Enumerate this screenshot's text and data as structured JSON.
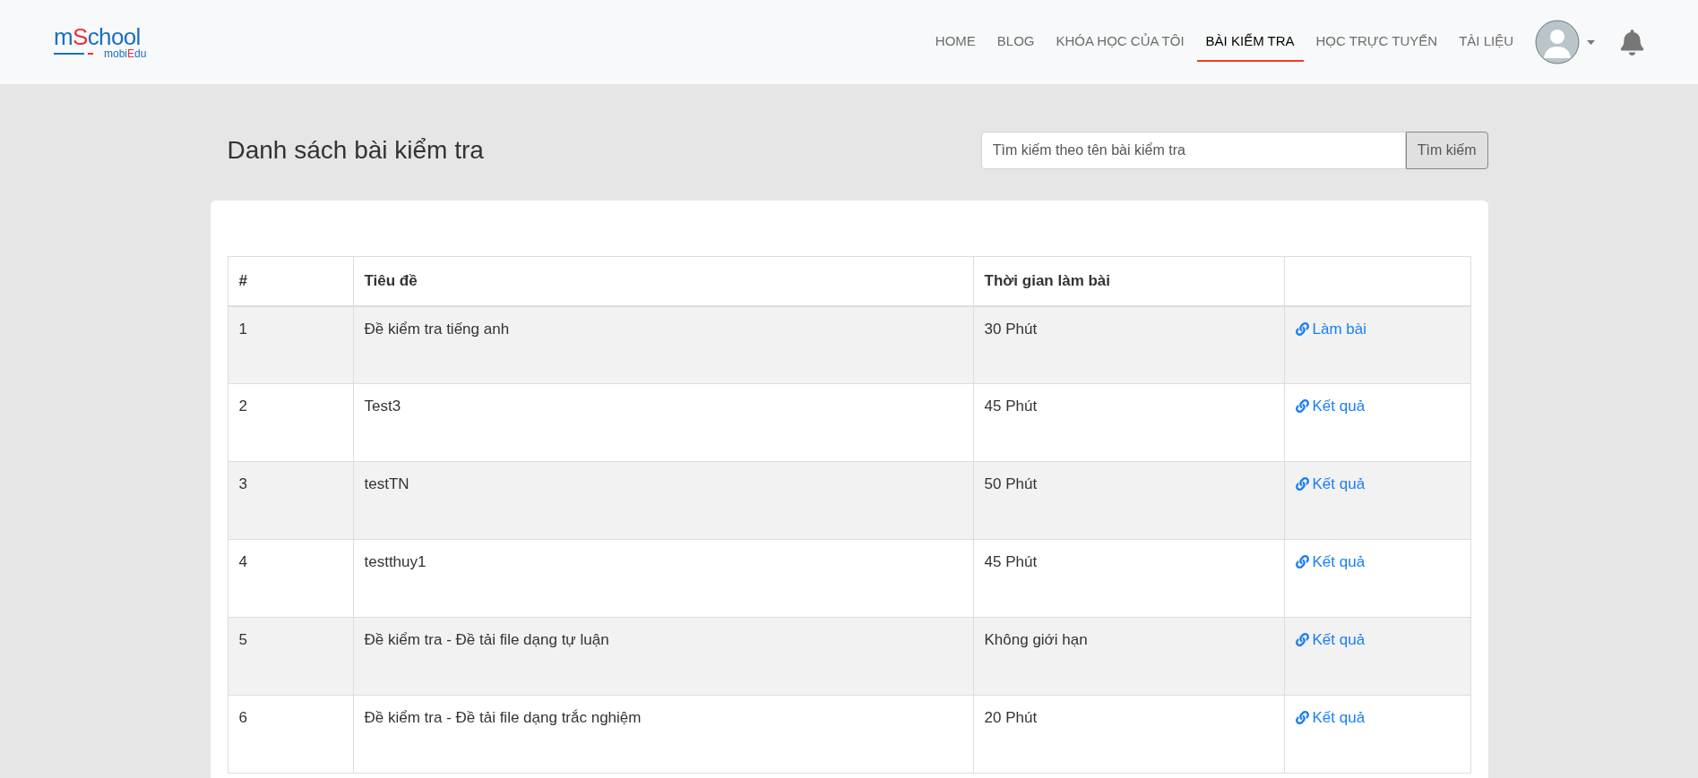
{
  "logo": {
    "parts": [
      {
        "text": "m",
        "accent": false
      },
      {
        "text": "S",
        "accent": true
      },
      {
        "text": "chool",
        "accent": false
      }
    ],
    "sub_parts": [
      {
        "text": "mobi",
        "accent": false
      },
      {
        "text": "E",
        "accent": true
      },
      {
        "text": "du",
        "accent": false
      }
    ]
  },
  "nav": [
    {
      "label": "HOME",
      "selected": false
    },
    {
      "label": "BLOG",
      "selected": false
    },
    {
      "label": "KHÓA HỌC CỦA TÔI",
      "selected": false
    },
    {
      "label": "BÀI KIỂM TRA",
      "selected": true
    },
    {
      "label": "HỌC TRỰC TUYẾN",
      "selected": false
    },
    {
      "label": "TÀI LIỆU",
      "selected": false
    }
  ],
  "page_title": "Danh sách bài kiểm tra",
  "search": {
    "placeholder": "Tìm kiếm theo tên bài kiểm tra",
    "button": "Tìm kiếm"
  },
  "table": {
    "columns": [
      "#",
      "Tiêu đề",
      "Thời gian làm bài"
    ],
    "rows": [
      {
        "index": "1",
        "title": "Đề kiểm tra tiếng anh",
        "duration": "30 Phút",
        "action": "Làm bài"
      },
      {
        "index": "2",
        "title": "Test3",
        "duration": "45 Phút",
        "action": "Kết quả"
      },
      {
        "index": "3",
        "title": "testTN",
        "duration": "50 Phút",
        "action": "Kết quả"
      },
      {
        "index": "4",
        "title": "testthuy1",
        "duration": "45 Phút",
        "action": "Kết quả"
      },
      {
        "index": "5",
        "title": "Đề kiểm tra - Đề tải file dạng tự luận",
        "duration": "Không giới hạn",
        "action": "Kết quả"
      },
      {
        "index": "6",
        "title": "Đề kiểm tra - Đề tải file dạng trắc nghiệm",
        "duration": "20 Phút",
        "action": "Kết quả"
      }
    ]
  }
}
